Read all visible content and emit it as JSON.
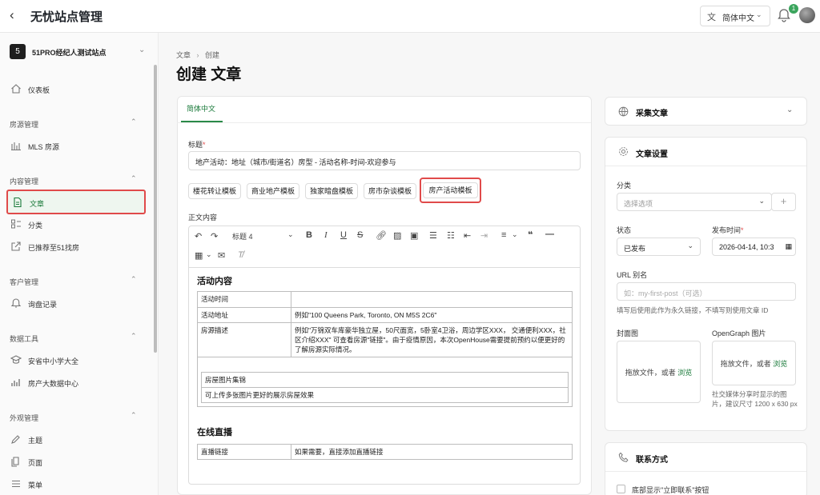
{
  "app": {
    "title": "无忧站点管理",
    "language": "简体中文",
    "notif_count": "1"
  },
  "sidebar": {
    "site_number": "5",
    "site_name": "51PRO经纪人测试站点",
    "sections": [
      {
        "label": "房源管理"
      },
      {
        "label": "内容管理"
      },
      {
        "label": "客户管理"
      },
      {
        "label": "数据工具"
      },
      {
        "label": "外观管理"
      }
    ],
    "items": {
      "dashboard": "仪表板",
      "mls": "MLS 房源",
      "articles": "文章",
      "categories": "分类",
      "recommended": "已推荐至51找房",
      "inquiries": "询盘记录",
      "schools": "安省中小学大全",
      "bigdata": "房产大数据中心",
      "themes": "主题",
      "pages": "页面",
      "menus": "菜单"
    }
  },
  "breadcrumb": {
    "parent": "文章",
    "sep": "›",
    "current": "创建"
  },
  "page_title": "创建 文章",
  "form": {
    "lang_tab": "简体中文",
    "title_label": "标题",
    "title_value": "地产活动：地址（城市/街道名）房型 - 活动名称-时间-欢迎参与",
    "templates": [
      "楼花转让模板",
      "商业地产模板",
      "独家暗盘模板",
      "房市杂谈模板",
      "房产活动模板"
    ],
    "body_label": "正文内容",
    "heading_select": "标题 4"
  },
  "editor": {
    "h1": "活动内容",
    "rows": [
      {
        "k": "活动时间",
        "v": ""
      },
      {
        "k": "活动地址",
        "v": "例如\"100 Queens Park, Toronto, ON M5S 2C6\""
      },
      {
        "k": "房源描述",
        "v": "例如\"万锦双车库豪华独立屋，50尺面宽，5卧室4卫浴，周边学区XXX， 交通便利XXX，社区介绍XXX\" 可查看房源\"链接\"。由于疫情原因，本次OpenHouse需要提前预约以便更好的了解房源实际情况。"
      }
    ],
    "gallery_title": "房屋图片集锦",
    "gallery_desc": "可上传多张图片更好的展示房屋效果",
    "h2": "在线直播",
    "live_k": "直播链接",
    "live_v": "如果需要，直接添加直播链接"
  },
  "right": {
    "collect": "采集文章",
    "settings": "文章设置",
    "category_label": "分类",
    "category_placeholder": "选择选项",
    "status_label": "状态",
    "status_value": "已发布",
    "publish_label": "发布时间",
    "publish_value": "2026-04-14, 10:3",
    "slug_label": "URL 别名",
    "slug_placeholder": "如：my-first-post（可选）",
    "slug_hint": "填写后使用此作为永久链接，不填写则使用文章 ID",
    "cover_label": "封面图",
    "og_label": "OpenGraph 图片",
    "drop_text": "拖放文件，或者",
    "browse": "浏览",
    "og_hint": "社交媒体分享时显示的图片，建议尺寸 1200 x 630 px",
    "contact": "联系方式",
    "contact_opt": "底部显示\"立即联系\"按钮"
  },
  "colors": {
    "accent": "#1a7a3a",
    "highlight": "#e04a4a"
  }
}
